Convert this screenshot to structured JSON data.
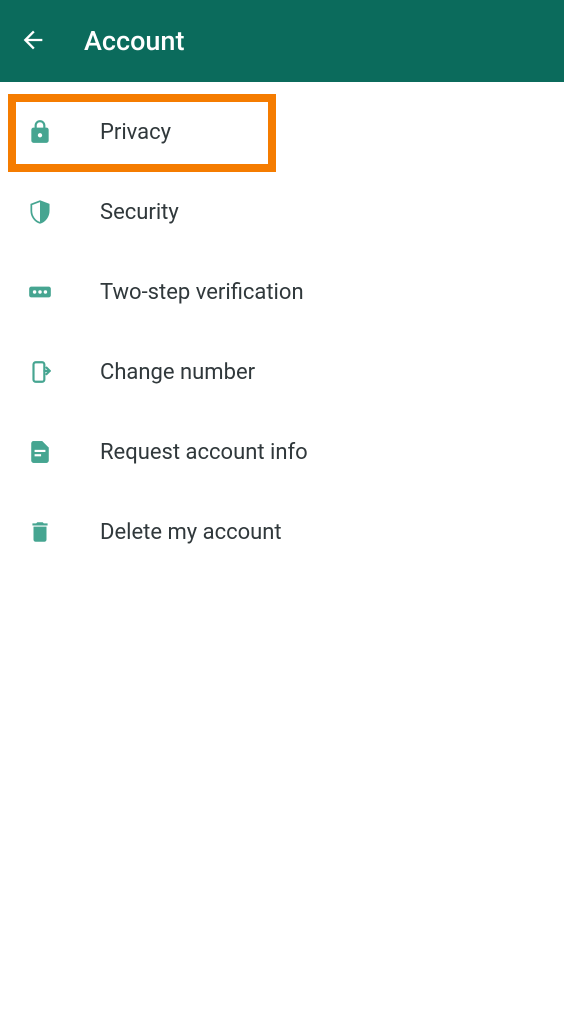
{
  "header": {
    "title": "Account"
  },
  "menu": {
    "items": [
      {
        "label": "Privacy"
      },
      {
        "label": "Security"
      },
      {
        "label": "Two-step verification"
      },
      {
        "label": "Change number"
      },
      {
        "label": "Request account info"
      },
      {
        "label": "Delete my account"
      }
    ]
  },
  "colors": {
    "header_bg": "#0b6b5c",
    "icon": "#46a591",
    "highlight": "#f57c00"
  }
}
